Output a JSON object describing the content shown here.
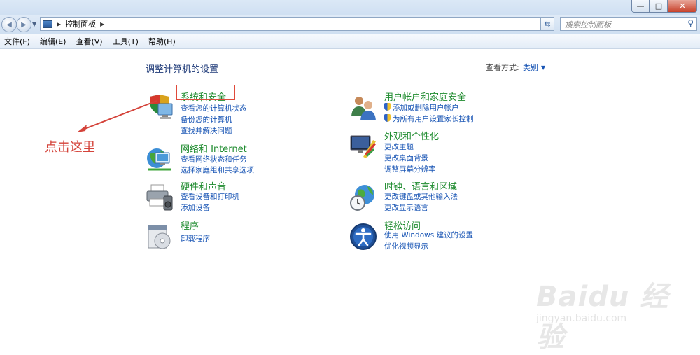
{
  "window": {
    "minimize_label": "—",
    "maximize_label": "□",
    "close_label": "✕"
  },
  "navigation": {
    "back_glyph": "◀",
    "forward_glyph": "▶",
    "breadcrumb": "控制面板",
    "search_placeholder": "搜索控制面板"
  },
  "menu": [
    "文件(F)",
    "编辑(E)",
    "查看(V)",
    "工具(T)",
    "帮助(H)"
  ],
  "main": {
    "heading": "调整计算机的设置",
    "view_by_label": "查看方式:",
    "view_by_value": "类别"
  },
  "categories_left": [
    {
      "title": "系统和安全",
      "icon": "system-security-icon",
      "links": [
        {
          "text": "查看您的计算机状态"
        },
        {
          "text": "备份您的计算机"
        },
        {
          "text": "查找并解决问题"
        }
      ]
    },
    {
      "title": "网络和 Internet",
      "icon": "network-icon",
      "links": [
        {
          "text": "查看网络状态和任务"
        },
        {
          "text": "选择家庭组和共享选项"
        }
      ]
    },
    {
      "title": "硬件和声音",
      "icon": "printer-icon",
      "links": [
        {
          "text": "查看设备和打印机"
        },
        {
          "text": "添加设备"
        }
      ]
    },
    {
      "title": "程序",
      "icon": "programs-icon",
      "links": [
        {
          "text": "卸载程序"
        }
      ]
    }
  ],
  "categories_right": [
    {
      "title": "用户帐户和家庭安全",
      "icon": "users-icon",
      "links": [
        {
          "text": "添加或删除用户帐户",
          "shield": true
        },
        {
          "text": "为所有用户设置家长控制",
          "shield": true
        }
      ]
    },
    {
      "title": "外观和个性化",
      "icon": "appearance-icon",
      "links": [
        {
          "text": "更改主题"
        },
        {
          "text": "更改桌面背景"
        },
        {
          "text": "调整屏幕分辨率"
        }
      ]
    },
    {
      "title": "时钟、语言和区域",
      "icon": "clock-globe-icon",
      "links": [
        {
          "text": "更改键盘或其他输入法"
        },
        {
          "text": "更改显示语言"
        }
      ]
    },
    {
      "title": "轻松访问",
      "icon": "ease-of-access-icon",
      "links": [
        {
          "text": "使用 Windows 建议的设置"
        },
        {
          "text": "优化视频显示"
        }
      ]
    }
  ],
  "annotation": {
    "text": "点击这里",
    "color": "#d4433a"
  },
  "watermark": {
    "brand": "Baidu 经验",
    "url": "jingyan.baidu.com"
  },
  "colors": {
    "category_title": "#1e8b2e",
    "link": "#1a56b5",
    "heading": "#1e3a78"
  }
}
